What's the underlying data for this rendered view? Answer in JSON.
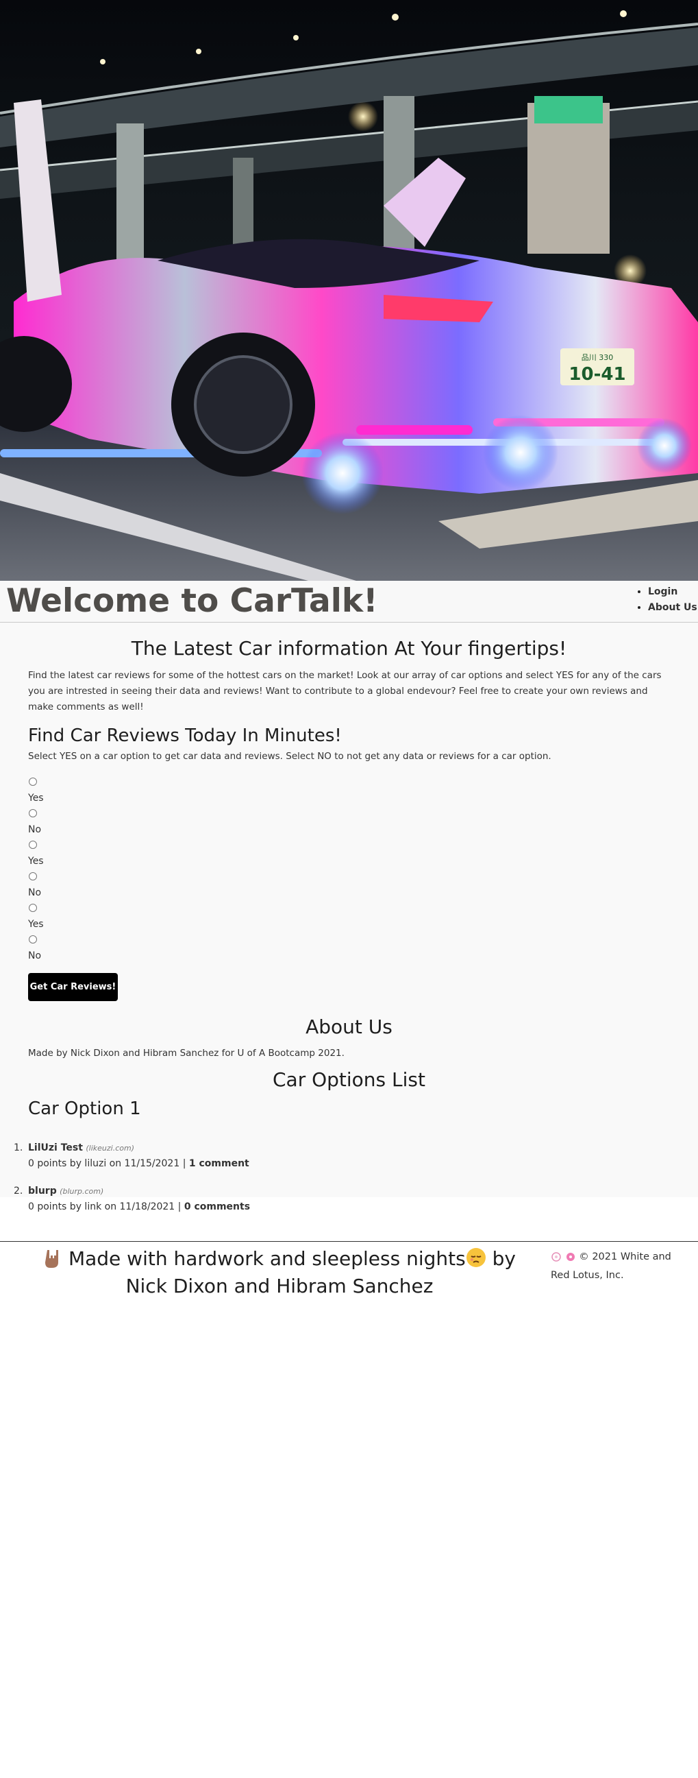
{
  "hero": {
    "plate_text": "10-41",
    "plate_top": "品川 330"
  },
  "header": {
    "title": "Welcome to CarTalk!"
  },
  "nav": [
    {
      "label": "Login"
    },
    {
      "label": "About Us"
    }
  ],
  "main": {
    "lead_title": "The Latest Car information At Your fingertips!",
    "intro": "Find the latest car reviews for some of the hottest cars on the market! Look at our array of car options and select YES for any of the cars you are intrested in seeing their data and reviews! Want to contribute to a global endevour? Feel free to create your own reviews and make comments as well!",
    "find_title": "Find Car Reviews Today In Minutes!",
    "instruction": "Select YES on a car option to get car data and reviews. Select NO to not get any data or reviews for a car option.",
    "radio_options": [
      {
        "label": "Yes"
      },
      {
        "label": "No"
      },
      {
        "label": "Yes"
      },
      {
        "label": "No"
      },
      {
        "label": "Yes"
      },
      {
        "label": "No"
      }
    ],
    "button_label": "Get Car Reviews!",
    "about_title": "About Us",
    "about_text": "Made by Nick Dixon and Hibram Sanchez for U of A Bootcamp 2021.",
    "options_title": "Car Options List",
    "option_heading": "Car Option 1",
    "cars": [
      {
        "num": "1.",
        "name": "LilUzi Test",
        "domain": "(likeuzi.com)",
        "meta": "0 points by liluzi on 11/15/2021 | ",
        "comments": "1 comment"
      },
      {
        "num": "2.",
        "name": "blurp",
        "domain": "(blurp.com)",
        "meta": "0 points by link on 11/18/2021 | ",
        "comments": "0 comments"
      }
    ]
  },
  "footer": {
    "line_before": "Made with hardwork and sleepless nights",
    "line_after": " by Nick Dixon and Hibram Sanchez",
    "copyright": "© 2021 White and Red Lotus, Inc."
  }
}
